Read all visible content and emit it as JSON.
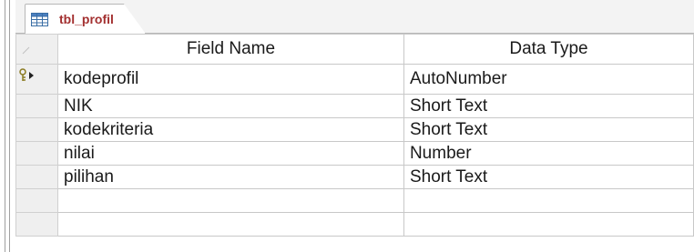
{
  "tab": {
    "icon": "table-icon",
    "label": "tbl_profil"
  },
  "columns": [
    "Field Name",
    "Data Type"
  ],
  "rows": [
    {
      "field": "kodeprofil",
      "type": "AutoNumber",
      "primary_key": true,
      "current": true
    },
    {
      "field": "NIK",
      "type": "Short Text"
    },
    {
      "field": "kodekriteria",
      "type": "Short Text"
    },
    {
      "field": "nilai",
      "type": "Number"
    },
    {
      "field": "pilihan",
      "type": "Short Text"
    },
    {
      "field": "",
      "type": ""
    },
    {
      "field": "",
      "type": ""
    }
  ],
  "colors": {
    "tab_text": "#a33030",
    "grid_line": "#c8c8c8",
    "selector": "#efefef"
  }
}
